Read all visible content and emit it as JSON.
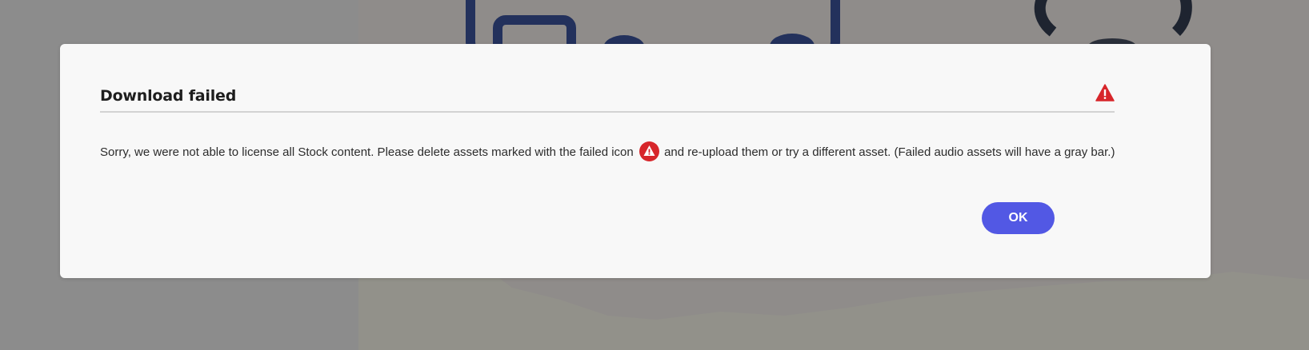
{
  "dialog": {
    "title": "Download failed",
    "header_icon": "alert-triangle-icon",
    "message_before_icon": "Sorry, we were not able to license all Stock content. Please delete assets marked with the failed icon",
    "inline_icon": "alert-circle-icon",
    "message_after_icon": "and re-upload them or try a different asset. (Failed audio assets will have a gray bar.)",
    "ok_label": "OK"
  },
  "colors": {
    "accent": "#5258e4",
    "alert": "#d7262b",
    "overlay": "#8c8c8c",
    "dialog_background": "#f8f8f8"
  }
}
